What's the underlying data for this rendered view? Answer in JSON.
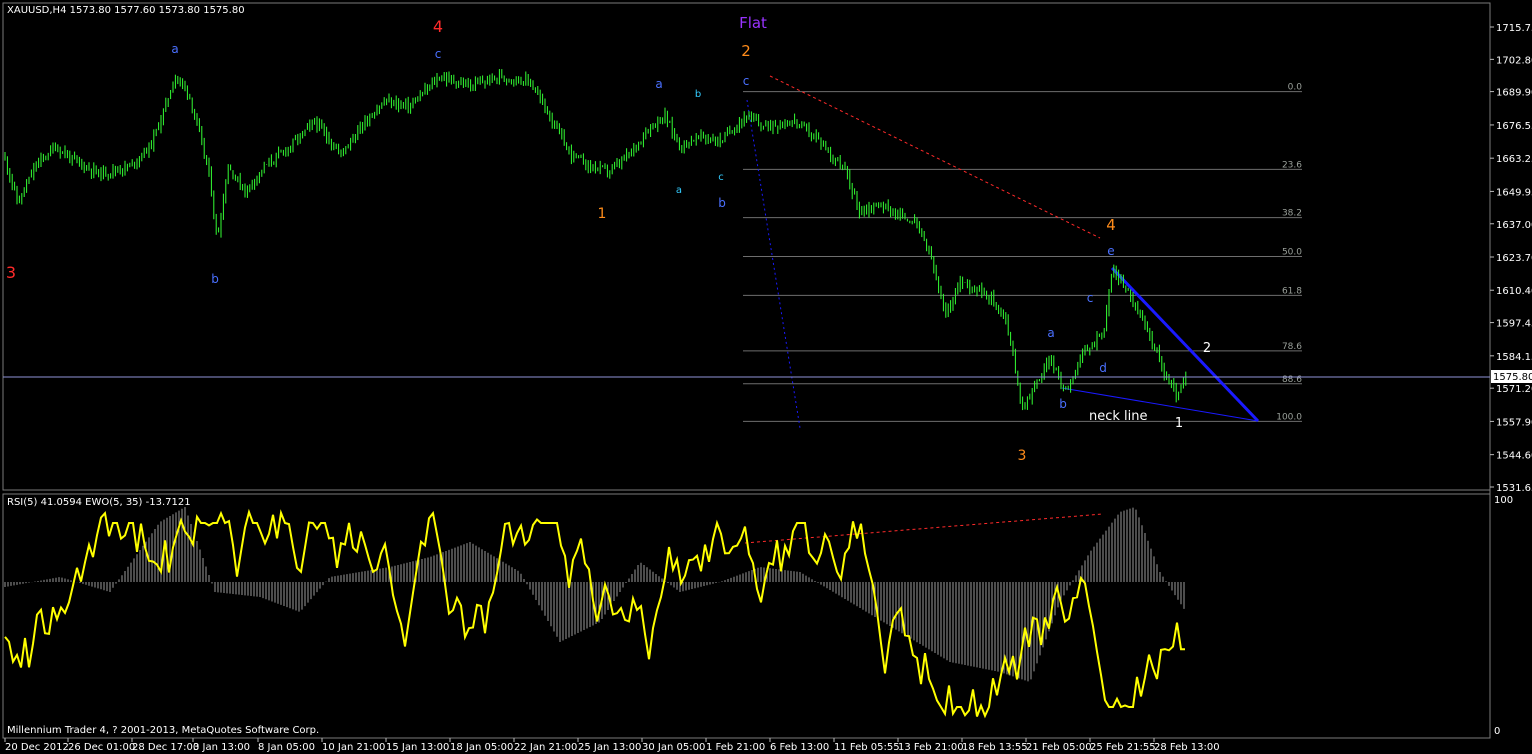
{
  "header": {
    "symbol_info": "XAUUSD,H4  1573.80 1577.60 1573.80 1575.80",
    "indicator_info": "RSI(5) 41.0594  EWO(5, 35) -13.7121",
    "copyright": "Millennium Trader 4, ? 2001-2013, MetaQuotes Software Corp."
  },
  "colors": {
    "background": "#000000",
    "candle": "#33ff33",
    "rsi": "#ffff00",
    "ewo": "#9a9a9a",
    "fib": "#6e6e6e",
    "triangle": "#1a1aff",
    "resistance": "#ff2a2a",
    "crosshair": "#8f93d8"
  },
  "price_axis": {
    "ticks": [
      "1715.75",
      "1702.80",
      "1689.90",
      "1676.55",
      "1663.25",
      "1649.95",
      "1637.00",
      "1623.70",
      "1610.40",
      "1597.45",
      "1584.15",
      "1571.20",
      "1557.90",
      "1544.60",
      "1531.65"
    ],
    "current_price": "1575.80"
  },
  "time_axis": {
    "ticks": [
      "20 Dec 2012",
      "26 Dec 01:00",
      "28 Dec 17:00",
      "3 Jan 13:00",
      "8 Jan 05:00",
      "10 Jan 21:00",
      "15 Jan 13:00",
      "18 Jan 05:00",
      "22 Jan 21:00",
      "25 Jan 13:00",
      "30 Jan 05:00",
      "1 Feb 21:00",
      "6 Feb 13:00",
      "11 Feb 05:55",
      "13 Feb 21:00",
      "18 Feb 13:55",
      "21 Feb 05:00",
      "25 Feb 21:55",
      "28 Feb 13:00"
    ]
  },
  "rsi_axis": {
    "ticks": [
      "100",
      "0"
    ]
  },
  "fib_levels": [
    "0.0",
    "23.6",
    "38.2",
    "50.0",
    "61.8",
    "78.6",
    "88.6",
    "100.0"
  ],
  "annotations": {
    "neck_line": "neck line",
    "flat": "Flat"
  },
  "wave_labels": [
    {
      "text": "3",
      "color": "#ff2a2a"
    },
    {
      "text": "a",
      "color": "#4a70ff"
    },
    {
      "text": "b",
      "color": "#4a70ff"
    },
    {
      "text": "4",
      "color": "#ff2a2a"
    },
    {
      "text": "c",
      "color": "#4a70ff"
    },
    {
      "text": "Flat",
      "color": "#9933ff"
    },
    {
      "text": "2",
      "color": "#ff8c1a"
    },
    {
      "text": "1",
      "color": "#ff8c1a"
    },
    {
      "text": "a",
      "color": "#4a70ff"
    },
    {
      "text": "b",
      "color": "#33ccff"
    },
    {
      "text": "a",
      "color": "#33ccff"
    },
    {
      "text": "c",
      "color": "#33ccff"
    },
    {
      "text": "b",
      "color": "#4a70ff"
    },
    {
      "text": "c",
      "color": "#4a70ff"
    },
    {
      "text": "4",
      "color": "#ff8c1a"
    },
    {
      "text": "e",
      "color": "#4a70ff"
    },
    {
      "text": "c",
      "color": "#4a70ff"
    },
    {
      "text": "a",
      "color": "#4a70ff"
    },
    {
      "text": "d",
      "color": "#4a70ff"
    },
    {
      "text": "b",
      "color": "#4a70ff"
    },
    {
      "text": "2",
      "color": "#ffffff"
    },
    {
      "text": "1",
      "color": "#ffffff"
    },
    {
      "text": "3",
      "color": "#ff8c1a"
    }
  ],
  "chart_data": {
    "type": "line",
    "title": "XAUUSD,H4",
    "ylim": [
      1531.65,
      1720
    ],
    "y_ticks": [
      1715.75,
      1702.8,
      1689.9,
      1676.55,
      1663.25,
      1649.95,
      1637.0,
      1623.7,
      1610.4,
      1597.45,
      1584.15,
      1571.2,
      1557.9,
      1544.6,
      1531.65
    ],
    "x": [
      "20 Dec 2012",
      "26 Dec 01:00",
      "28 Dec 17:00",
      "3 Jan 13:00",
      "8 Jan 05:00",
      "10 Jan 21:00",
      "15 Jan 13:00",
      "18 Jan 05:00",
      "22 Jan 21:00",
      "25 Jan 13:00",
      "30 Jan 05:00",
      "1 Feb 21:00",
      "6 Feb 13:00",
      "11 Feb 05:55",
      "13 Feb 21:00",
      "18 Feb 13:55",
      "21 Feb 05:00",
      "25 Feb 21:55",
      "28 Feb 13:00"
    ],
    "series": [
      {
        "values": [
          1663,
          1652,
          1668,
          1692,
          1645,
          1665,
          1678,
          1686,
          1692,
          1696,
          1660,
          1678,
          1672,
          1678,
          1642,
          1614,
          1563,
          1580,
          1619,
          1575,
          1576
        ]
      },
      {
        "values": [
          50,
          40,
          85,
          10,
          60,
          45,
          80,
          55,
          70,
          50,
          15,
          80,
          55,
          70,
          30,
          60,
          25,
          65,
          80,
          20,
          40
        ]
      }
    ],
    "fib_retracement": {
      "from": 1689.9,
      "to": 1557.9,
      "levels": [
        0.0,
        23.6,
        38.2,
        50.0,
        61.8,
        78.6,
        88.6,
        100.0
      ]
    },
    "current_price": 1575.8,
    "rsi_range": [
      0,
      100
    ]
  }
}
